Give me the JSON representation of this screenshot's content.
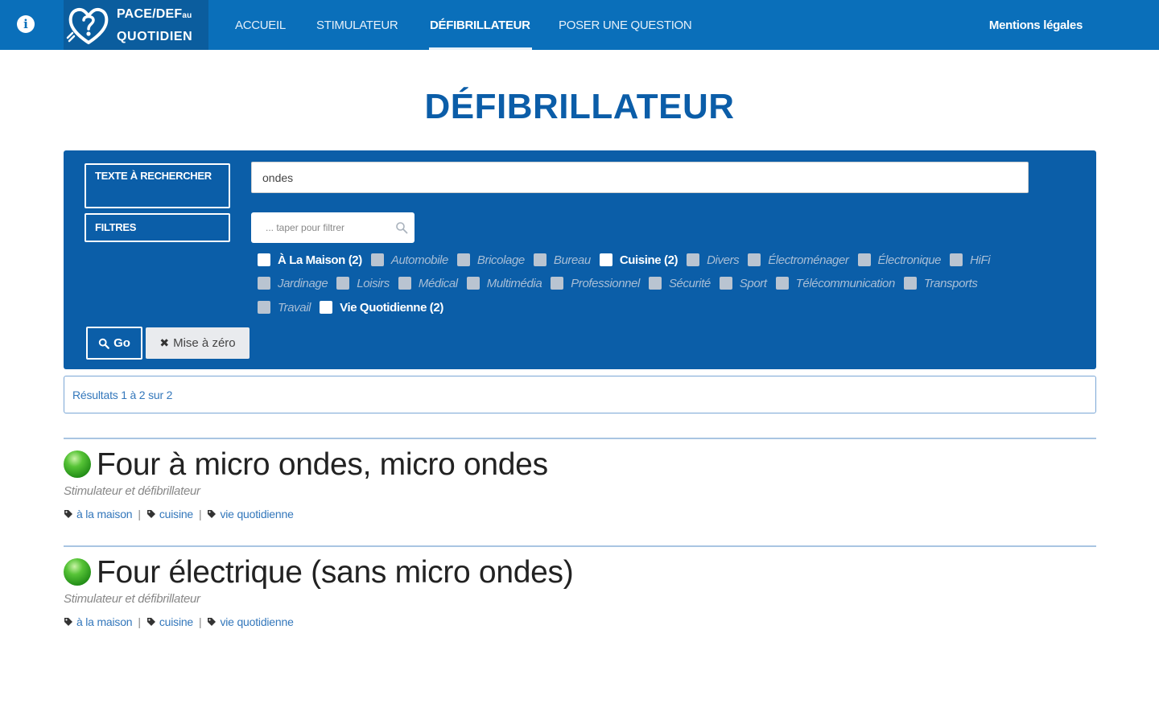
{
  "nav": {
    "brand_line1": "PACE/DEF",
    "brand_line1_small": "au",
    "brand_line2": "QUOTIDIEN",
    "items": [
      {
        "label": "ACCUEIL",
        "active": false
      },
      {
        "label": "STIMULATEUR",
        "active": false
      },
      {
        "label": "DÉFIBRILLATEUR",
        "active": true
      },
      {
        "label": "POSER UNE QUESTION",
        "active": false
      }
    ],
    "right_link": "Mentions légales"
  },
  "page": {
    "title": "DÉFIBRILLATEUR"
  },
  "search": {
    "text_label": "TEXTE À RECHERCHER",
    "text_value": "ondes",
    "filters_label": "FILTRES",
    "filter_placeholder": "... taper pour filtrer",
    "categories": [
      {
        "label": "À La Maison (2)",
        "checked": true,
        "enabled": true
      },
      {
        "label": "Automobile",
        "checked": false,
        "enabled": false
      },
      {
        "label": "Bricolage",
        "checked": false,
        "enabled": false
      },
      {
        "label": "Bureau",
        "checked": false,
        "enabled": false
      },
      {
        "label": "Cuisine (2)",
        "checked": true,
        "enabled": true
      },
      {
        "label": "Divers",
        "checked": false,
        "enabled": false
      },
      {
        "label": "Électroménager",
        "checked": false,
        "enabled": false
      },
      {
        "label": "Électronique",
        "checked": false,
        "enabled": false
      },
      {
        "label": "HiFi",
        "checked": false,
        "enabled": false
      },
      {
        "label": "Jardinage",
        "checked": false,
        "enabled": false
      },
      {
        "label": "Loisirs",
        "checked": false,
        "enabled": false
      },
      {
        "label": "Médical",
        "checked": false,
        "enabled": false
      },
      {
        "label": "Multimédia",
        "checked": false,
        "enabled": false
      },
      {
        "label": "Professionnel",
        "checked": false,
        "enabled": false
      },
      {
        "label": "Sécurité",
        "checked": false,
        "enabled": false
      },
      {
        "label": "Sport",
        "checked": false,
        "enabled": false
      },
      {
        "label": "Télécommunication",
        "checked": false,
        "enabled": false
      },
      {
        "label": "Transports",
        "checked": false,
        "enabled": false
      },
      {
        "label": "Travail",
        "checked": false,
        "enabled": false
      },
      {
        "label": "Vie Quotidienne (2)",
        "checked": true,
        "enabled": true
      }
    ],
    "go_label": "Go",
    "reset_label": "Mise à zéro"
  },
  "results": {
    "summary": "Résultats 1 à 2 sur 2",
    "items": [
      {
        "title": "Four à micro ondes, micro ondes",
        "subtitle": "Stimulateur et défibrillateur",
        "status_color": "#3fae2a",
        "tags": [
          "à la maison",
          "cuisine",
          "vie quotidienne"
        ]
      },
      {
        "title": "Four électrique (sans micro ondes)",
        "subtitle": "Stimulateur et défibrillateur",
        "status_color": "#3fae2a",
        "tags": [
          "à la maison",
          "cuisine",
          "vie quotidienne"
        ]
      }
    ]
  },
  "colors": {
    "nav_bg": "#0a6fba",
    "panel_bg": "#0b5ea8",
    "title": "#0b5da8",
    "link": "#3377bb"
  },
  "icons": [
    "info-icon",
    "heart-question-logo",
    "search-icon",
    "close-icon",
    "tag-icon",
    "status-dot-icon"
  ]
}
